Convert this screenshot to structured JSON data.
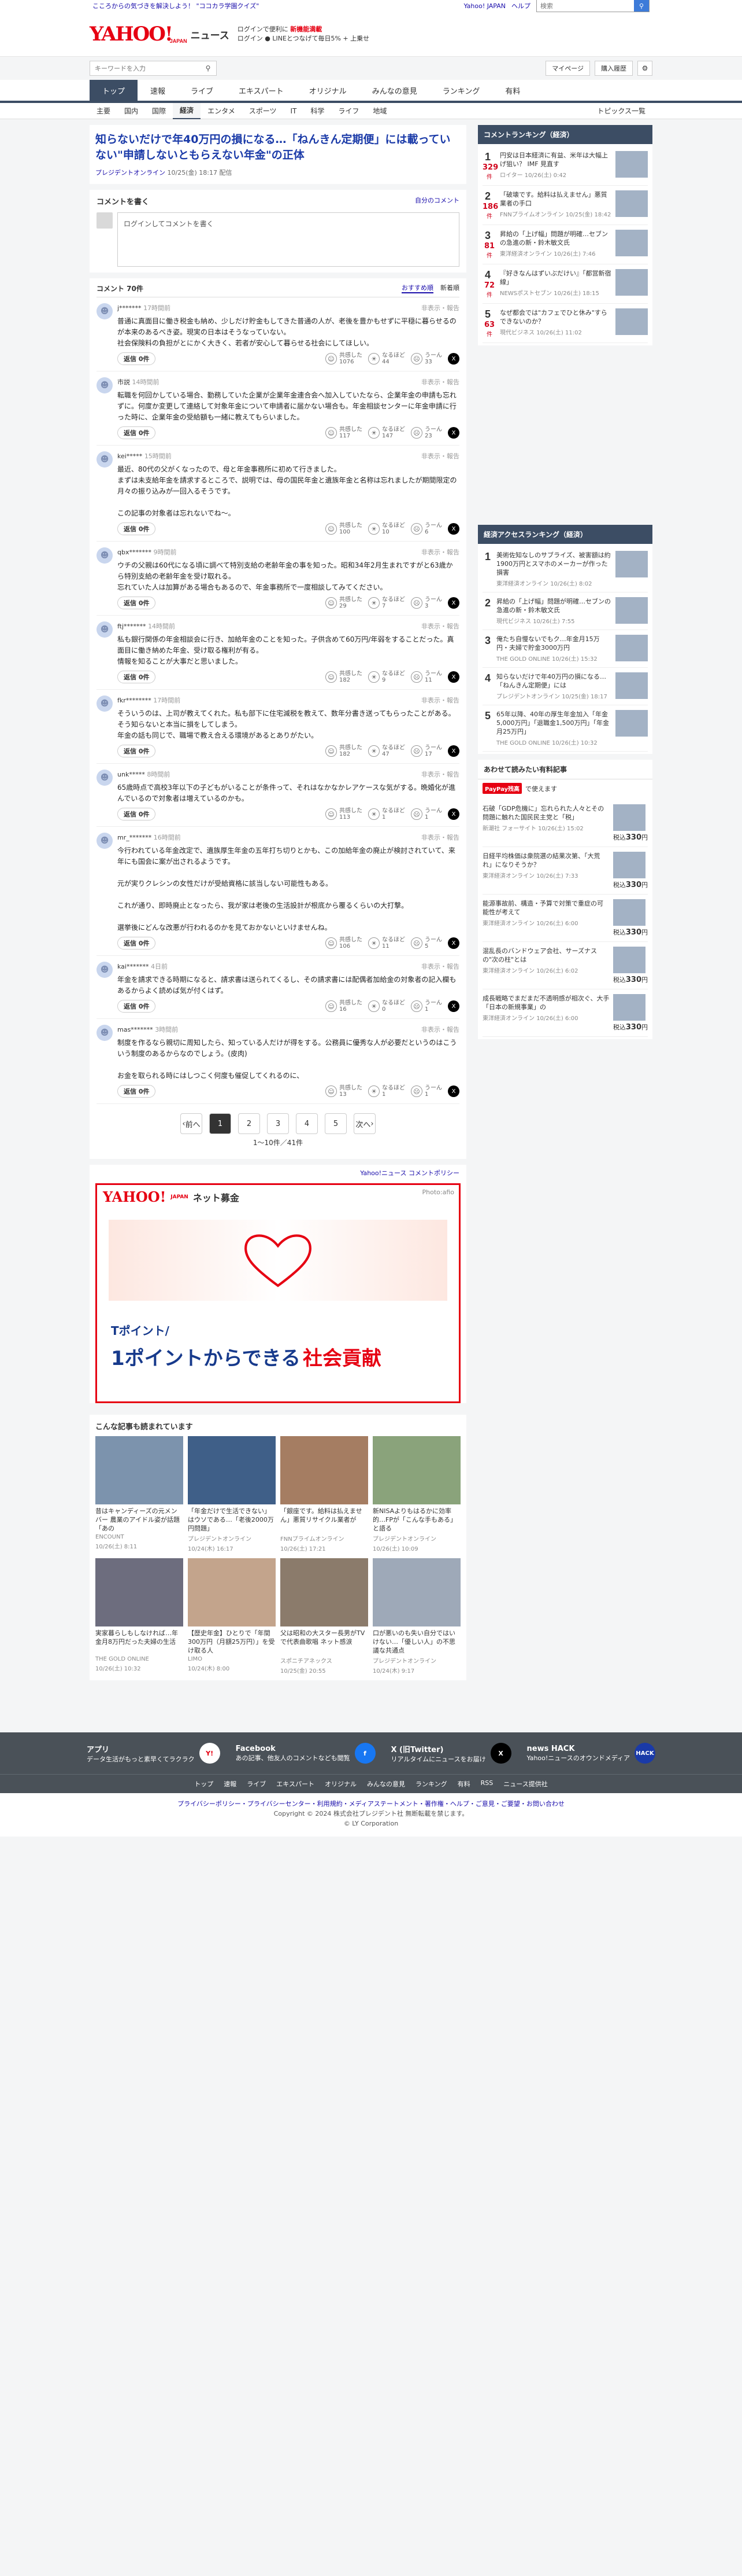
{
  "promo": {
    "left": "こころからの気づきを解決しよう！ \"ココカラ学園クイズ\"",
    "links": [
      "Yahoo! JAPAN",
      "ヘルプ"
    ],
    "search_placeholder": "検索"
  },
  "header": {
    "logo": "YAHOO!",
    "logo_sub": "JAPAN",
    "service": "ニュース",
    "promo_line1": "ログインで便利に",
    "promo_line1_b": "新機能満載",
    "promo_line2": "ログイン ● LINEとつなげて毎日5% + 上乗せ"
  },
  "toolbar": {
    "search_placeholder": "キーワードを入力",
    "mypage": "マイページ",
    "purchase": "購入履歴"
  },
  "nav": [
    "トップ",
    "速報",
    "ライブ",
    "エキスパート",
    "オリジナル",
    "みんなの意見",
    "ランキング",
    "有料"
  ],
  "subnav": [
    "主要",
    "国内",
    "国際",
    "経済",
    "エンタメ",
    "スポーツ",
    "IT",
    "科学",
    "ライフ",
    "地域"
  ],
  "subnav_right": "トピックス一覧",
  "article": {
    "title": "知らないだけで年40万円の損になる…「ねんきん定期便」には載っていない\"申請しないともらえない年金\"の正体",
    "source": "プレジデントオンライン",
    "date": "10/25(金) 18:17 配信"
  },
  "comment_write": {
    "title": "コメントを書く",
    "policy": "自分のコメント",
    "placeholder": "ログインしてコメントを書く"
  },
  "comments_header": {
    "count": "コメント 70件",
    "sort_recommend": "おすすめ順",
    "sort_new": "新着順"
  },
  "comments": [
    {
      "user": "j*******",
      "time": "17時間前",
      "text": "普通に真面目に働き税金も納め、少しだけ貯金もしてきた普通の人が、老後を豊かもせずに平穏に暮らせるのが本来のあるべき姿。現実の日本はそうなっていない。\n社会保険料の負担がとにかく大きく、若者が安心して暮らせる社会にしてほしい。",
      "reply": "返信 0件",
      "v1": "1076",
      "v2": "44",
      "v3": "33"
    },
    {
      "user": "市説",
      "time": "14時間前",
      "text": "転職を何回かしている場合、勤務していた企業が企業年金連合会へ加入していたなら、企業年金の申請も忘れずに。何度か変更して連絡して対象年金について申請者に届かない場合も。年金相談センターに年金申請に行った時に、企業年金の受給額も一緒に教えてもらいました。",
      "reply": "返信 0件",
      "v1": "117",
      "v2": "147",
      "v3": "23"
    },
    {
      "user": "kei*****",
      "time": "15時間前",
      "text": "最近、80代の父がくなったので、母と年金事務所に初めて行きました。\nまずは未支給年金を請求するところで、説明では、母の国民年金と遺族年金と名称は忘れましたが期間限定の月々の振り込みが一回入るそうです。\n\nこの記事の対象者は忘れないでね〜。",
      "reply": "返信 0件",
      "v1": "100",
      "v2": "10",
      "v3": "6"
    },
    {
      "user": "qbx*******",
      "time": "9時間前",
      "text": "ウチの父親は60代になる頃に調べて特別支給の老齢年金の事を知った。昭和34年2月生まれですがと63歳から特別支給の老齢年金を受け取れる。\n忘れていた人は加算がある場合もあるので、年金事務所で一度相談してみてください。",
      "reply": "返信 0件",
      "v1": "29",
      "v2": "7",
      "v3": "3"
    },
    {
      "user": "ftj*******",
      "time": "14時間前",
      "text": "私も銀行関係の年金相談会に行き、加給年金のことを知った。子供含めて60万円/年弱をすることだった。真面目に働き納めた年金、受け取る権利が有る。\n情報を知ることが大事だと思いました。",
      "reply": "返信 0件",
      "v1": "182",
      "v2": "9",
      "v3": "11"
    },
    {
      "user": "fkr********",
      "time": "17時間前",
      "text": "そういうのは、上司が教えてくれた。私も部下に住宅減税を教えて、数年分書き送ってもらったことがある。そう知らないと本当に損をしてしまう。\n年金の話も同じで、職場で教え合える環境があるとありがたい。",
      "reply": "返信 0件",
      "v1": "182",
      "v2": "47",
      "v3": "17"
    },
    {
      "user": "unk*****",
      "time": "8時間前",
      "text": "65歳時点で高校3年以下の子どもがいることが条件って、それはなかなかレアケースな気がする。晩婚化が進んでいるので対象者は増えているのかも。",
      "reply": "返信 0件",
      "v1": "113",
      "v2": "1",
      "v3": "1"
    },
    {
      "user": "mr_*******",
      "time": "16時間前",
      "text": "今行われている年金改定で、遺族厚生年金の五年打ち切りとかも、この加給年金の廃止が検討されていて、来年にも国会に案が出されるようです。\n\n元が実りクレシンの女性だけが受給資格に該当しない可能性もある。\n\nこれが通り、即時廃止となったら、我が家は老後の生活設計が根底から覆るくらいの大打撃。\n\n選挙後にどんな改悪が行われるのかを見ておかないといけませんね。",
      "reply": "返信 0件",
      "v1": "106",
      "v2": "11",
      "v3": "5"
    },
    {
      "user": "kai*******",
      "time": "4日前",
      "text": "年金を請求できる時期になると、請求書は送られてくるし、その請求書には配偶者加給金の対象者の記入欄もあるからよく読めば気が付くはず。",
      "reply": "返信 0件",
      "v1": "16",
      "v2": "0",
      "v3": "1"
    },
    {
      "user": "mas*******",
      "time": "3時間前",
      "text": "制度を作るなら親切に周知したら、知っている人だけが得をする。公務員に優秀な人が必要だというのはこういう制度のあるからなのでしょう。(皮肉)\n\nお金を取られる時にはしつこく何度も催促してくれるのに、",
      "reply": "返信 0件",
      "v1": "13",
      "v2": "1",
      "v3": "1"
    }
  ],
  "vote_labels": {
    "a1": "共感した",
    "a2": "なるほど",
    "a3": "うーん"
  },
  "report": "非表示・報告",
  "pagination": {
    "prev": "前へ",
    "pages": [
      "1",
      "2",
      "3",
      "4",
      "5"
    ],
    "next": "次へ",
    "count": "1〜10件／41件"
  },
  "comment_policy": "Yahoo!ニュース コメントポリシー",
  "ad": {
    "logo": "YAHOO!",
    "logo_sub": "JAPAN",
    "brand": "ネット募金",
    "credit": "Photo:afio",
    "line1": "Tポイント/",
    "line2": "1ポイントからできる",
    "line2_em": "社会貢献"
  },
  "recommend": {
    "title": "こんな記事も読まれています",
    "items": [
      {
        "t": "昔はキャンディーズの元メンバー 農業のアイドル姿が話題「あの",
        "s": "ENCOUNT",
        "d": "10/26(土) 8:11"
      },
      {
        "t": "「年金だけで生活できない」はウソである…「老後2000万円問題」",
        "s": "プレジデントオンライン",
        "d": "10/24(木) 16:17"
      },
      {
        "t": "「銀座です。給料は払えません」悪質リサイクル業者が",
        "s": "FNNプライムオンライン",
        "d": "10/26(土) 17:21"
      },
      {
        "t": "新NISAよりもはるかに効率的…FPが「こんな手もある」と語る",
        "s": "プレジデントオンライン",
        "d": "10/26(土) 10:09"
      },
      {
        "t": "実家暮らしもしなければ…年金月8万円だった夫婦の生活",
        "s": "THE GOLD ONLINE",
        "d": "10/26(土) 10:32"
      },
      {
        "t": "【歴史年金】ひとりで「年間300万円（月額25万円）」を受け取る人",
        "s": "LIMO",
        "d": "10/24(木) 8:00"
      },
      {
        "t": "父は昭和の大スター長男がTVで代表曲歌唱 ネット感涙",
        "s": "スポニチアネックス",
        "d": "10/25(金) 20:55"
      },
      {
        "t": "口が悪いのも失い自分ではいけない…「優しい人」の不思議な共通点",
        "s": "プレジデントオンライン",
        "d": "10/24(木) 9:17"
      }
    ]
  },
  "side_comment_ranking": {
    "title": "コメントランキング（経済）",
    "items": [
      {
        "rank": "1",
        "count": "329",
        "t": "円安は日本経済に有益、米年は大幅上げ狙い？ IMF 見直す",
        "s": "ロイター",
        "d": "10/26(土) 0:42"
      },
      {
        "rank": "2",
        "count": "186",
        "t": "「破壊です。給料は払えません」悪質業者の手口",
        "s": "FNNプライムオンライン",
        "d": "10/25(金) 18:42"
      },
      {
        "rank": "3",
        "count": "81",
        "t": "昇給の「上げ幅」問題が明確…セブンの急進の新・鈴木敏文氏",
        "s": "東洋経済オンライン",
        "d": "10/26(土) 7:46"
      },
      {
        "rank": "4",
        "count": "72",
        "t": "『好きなんはずいぶだけい』「都営新宿線」",
        "s": "NEWSポストセブン",
        "d": "10/26(土) 18:15"
      },
      {
        "rank": "5",
        "count": "63",
        "t": "なぜ都会では\"カフェでひと休み\"すらできないのか？",
        "s": "現代ビジネス",
        "d": "10/26(土) 11:02"
      }
    ],
    "unit": "件"
  },
  "side_access_ranking": {
    "title": "経済アクセスランキング（経済）",
    "items": [
      {
        "rank": "1",
        "t": "美術佐知なしのサブライズ、被害額は約1900万円とスマホのメーカーが作った損害",
        "s": "東洋経済オンライン",
        "d": "10/26(土) 8:02"
      },
      {
        "rank": "2",
        "t": "昇給の「上げ幅」問題が明確…セブンの急進の新・鈴木敏文氏",
        "s": "現代ビジネス",
        "d": "10/26(土) 7:55"
      },
      {
        "rank": "3",
        "t": "俺たち自慢ないでもク…年金月15万円・夫婦で貯金3000万円",
        "s": "THE GOLD ONLINE",
        "d": "10/26(土) 15:32"
      },
      {
        "rank": "4",
        "t": "知らないだけで年40万円の損になる…「ねんきん定期便」には",
        "s": "プレジデントオンライン",
        "d": "10/25(金) 18:17"
      },
      {
        "rank": "5",
        "t": "65年以降、40年の厚生年金加入「年金5,000万円」「退職金1,500万円」「年金月25万円」",
        "s": "THE GOLD ONLINE",
        "d": "10/26(土) 10:32"
      }
    ]
  },
  "paid_articles": {
    "title": "あわせて読みたい有料記事",
    "badge": "PayPay残高",
    "badge_suffix": "で使えます",
    "items": [
      {
        "t": "石破「GDP危機に」忘れられた人々とその問題に触れた国民民主党と「税」",
        "s": "新潮社 フォーサイト",
        "d": "10/26(土) 15:02",
        "price": "330",
        "unit": "円"
      },
      {
        "t": "日経平均株価は衆院選の結果次第、「大荒れ」になりそうか？",
        "s": "東洋経済オンライン",
        "d": "10/26(土) 7:33",
        "price": "330",
        "unit": "円"
      },
      {
        "t": "能源事故前、構造・予算で対策で重症の可能性が考えて",
        "s": "東洋経済オンライン",
        "d": "10/26(土) 6:00",
        "price": "330",
        "unit": "円"
      },
      {
        "t": "混乱長のバンドウェア会社、サーズナスの\"次の柱\"とは",
        "s": "東洋経済オンライン",
        "d": "10/26(土) 6:02",
        "price": "330",
        "unit": "円"
      },
      {
        "t": "成長戦略でまだまだ不透明感が相次ぐ、大手「日本の新規事業」の",
        "s": "東洋経済オンライン",
        "d": "10/26(土) 6:00",
        "price": "330",
        "unit": "円"
      }
    ],
    "price_prefix": "税込"
  },
  "footer": {
    "apps": [
      {
        "name": "アプリ",
        "desc": "データ生活がもっと素早くてラクラク"
      },
      {
        "name": "Facebook",
        "desc": "あの記事、他友人のコメントなども閲覧"
      },
      {
        "name": "X (旧Twitter)",
        "desc": "リアルタイムにニュースをお届け"
      },
      {
        "name": "news HACK",
        "desc": "Yahoo!ニュースのオウンドメディア"
      }
    ],
    "links": [
      "トップ",
      "速報",
      "ライブ",
      "エキスパート",
      "オリジナル",
      "みんなの意見",
      "ランキング",
      "有料",
      "RSS",
      "ニュース提供社"
    ],
    "legal1": "プライバシーポリシー・プライバシーセンター・利用規約・メディアステートメント・著作権・ヘルプ・ご意見・ご要望・お問い合わせ",
    "copyright": "Copyright © 2024 株式会社プレジデント社 無断転載を禁じます。",
    "corp": "© LY Corporation"
  }
}
